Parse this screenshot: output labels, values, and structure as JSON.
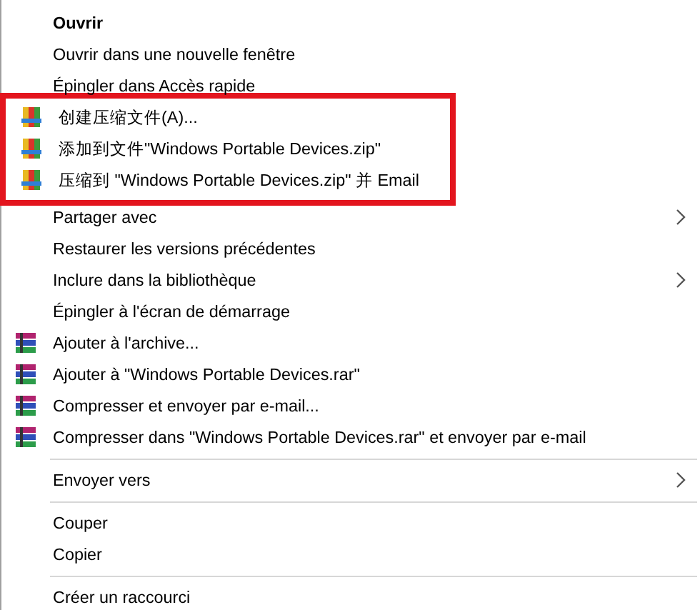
{
  "menu": {
    "items": [
      {
        "kind": "item",
        "label": "Ouvrir",
        "bold": true
      },
      {
        "kind": "item",
        "label": "Ouvrir dans une nouvelle fenêtre"
      },
      {
        "kind": "item",
        "label": "Épingler dans Accès rapide"
      },
      {
        "kind": "zip-item",
        "label": "创建压缩文件(A)...",
        "highlighted": true
      },
      {
        "kind": "zip-item",
        "label": "添加到文件\"Windows Portable Devices.zip\"",
        "highlighted": true
      },
      {
        "kind": "zip-item",
        "label": "压缩到 \"Windows Portable Devices.zip\" 并 Email",
        "highlighted": true
      },
      {
        "kind": "item",
        "label": "Partager avec",
        "submenu": true
      },
      {
        "kind": "item",
        "label": "Restaurer les versions précédentes"
      },
      {
        "kind": "item",
        "label": "Inclure dans la bibliothèque",
        "submenu": true
      },
      {
        "kind": "item",
        "label": "Épingler à l'écran de démarrage"
      },
      {
        "kind": "rar-item",
        "label": "Ajouter à l'archive..."
      },
      {
        "kind": "rar-item",
        "label": "Ajouter à \"Windows Portable Devices.rar\""
      },
      {
        "kind": "rar-item",
        "label": "Compresser et envoyer par e-mail..."
      },
      {
        "kind": "rar-item",
        "label": "Compresser dans \"Windows Portable Devices.rar\" et envoyer par e-mail"
      },
      {
        "kind": "separator"
      },
      {
        "kind": "item",
        "label": "Envoyer vers",
        "submenu": true
      },
      {
        "kind": "separator"
      },
      {
        "kind": "item",
        "label": "Couper"
      },
      {
        "kind": "item",
        "label": "Copier"
      },
      {
        "kind": "separator"
      },
      {
        "kind": "item",
        "label": "Créer un raccourci"
      }
    ]
  }
}
